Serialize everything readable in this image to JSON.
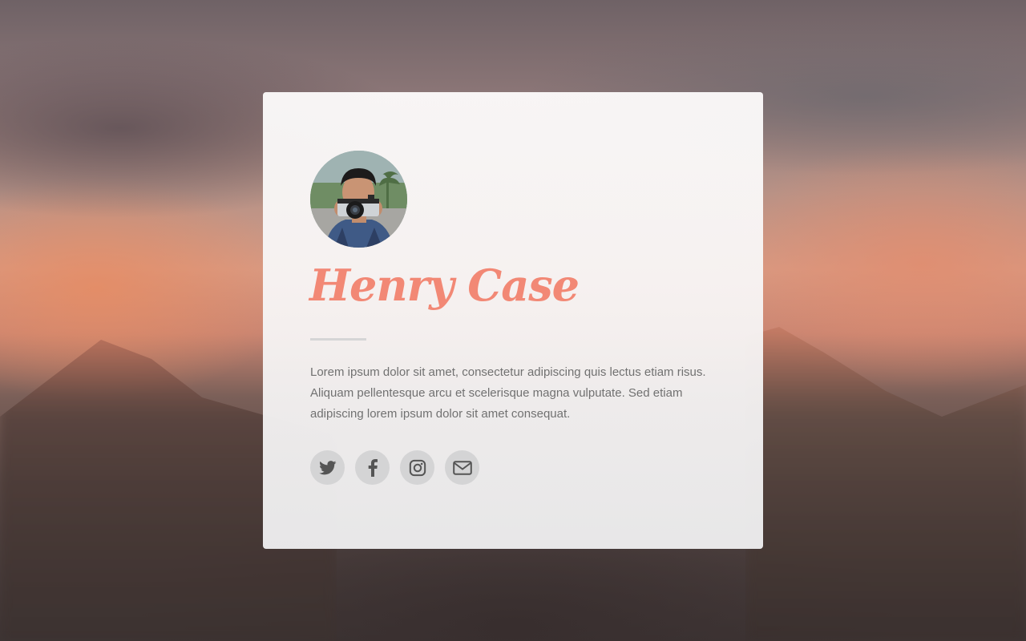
{
  "profile": {
    "name": "Henry Case",
    "bio": "Lorem ipsum dolor sit amet, consectetur adipiscing quis lectus etiam risus. Aliquam pellentesque arcu et scelerisque magna vulputate. Sed etiam adipiscing lorem ipsum dolor sit amet consequat."
  },
  "social": [
    {
      "icon": "twitter-icon"
    },
    {
      "icon": "facebook-icon"
    },
    {
      "icon": "instagram-icon"
    },
    {
      "icon": "envelope-icon"
    }
  ],
  "colors": {
    "accent": "#f28875",
    "text": "#717171",
    "icon_bg": "#d4d4d5",
    "icon_fg": "#555555"
  }
}
